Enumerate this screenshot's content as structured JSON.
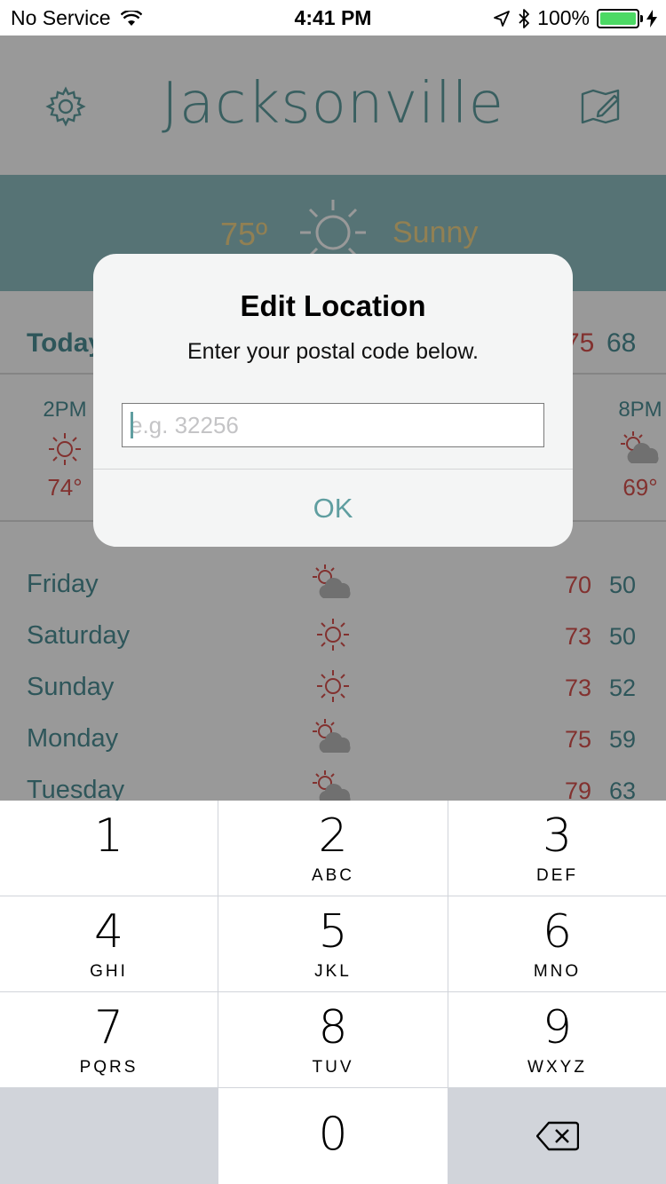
{
  "status_bar": {
    "carrier": "No Service",
    "time": "4:41 PM",
    "battery": "100%"
  },
  "header": {
    "title": "Jacksonville",
    "left_icon": "gear-icon",
    "right_icon": "edit-map-icon"
  },
  "current": {
    "temp": "75º",
    "condition": "Sunny",
    "icon": "sun-icon"
  },
  "today": {
    "label": "Today",
    "hi": "75",
    "lo": "68"
  },
  "hourly": [
    {
      "hour": "2PM",
      "temp": "74°",
      "icon": "sun-icon"
    },
    {
      "hour": "8PM",
      "temp": "69°",
      "icon": "partly-cloudy-icon"
    }
  ],
  "daily": [
    {
      "day": "Friday",
      "hi": "70",
      "lo": "50",
      "icon": "partly-cloudy-icon"
    },
    {
      "day": "Saturday",
      "hi": "73",
      "lo": "50",
      "icon": "sun-icon"
    },
    {
      "day": "Sunday",
      "hi": "73",
      "lo": "52",
      "icon": "sun-icon"
    },
    {
      "day": "Monday",
      "hi": "75",
      "lo": "59",
      "icon": "partly-cloudy-icon"
    },
    {
      "day": "Tuesday",
      "hi": "79",
      "lo": "63",
      "icon": "partly-cloudy-icon"
    }
  ],
  "alert": {
    "title": "Edit Location",
    "message": "Enter your postal code below.",
    "placeholder": "e.g. 32256",
    "value": "",
    "ok_label": "OK"
  },
  "keypad": {
    "keys": [
      {
        "num": "1",
        "letters": ""
      },
      {
        "num": "2",
        "letters": "ABC"
      },
      {
        "num": "3",
        "letters": "DEF"
      },
      {
        "num": "4",
        "letters": "GHI"
      },
      {
        "num": "5",
        "letters": "JKL"
      },
      {
        "num": "6",
        "letters": "MNO"
      },
      {
        "num": "7",
        "letters": "PQRS"
      },
      {
        "num": "8",
        "letters": "TUV"
      },
      {
        "num": "9",
        "letters": "WXYZ"
      },
      {
        "num": "0",
        "letters": ""
      }
    ],
    "delete_icon": "backspace-icon"
  },
  "colors": {
    "accent": "#5f9ea0",
    "hi_temp": "#d9534f",
    "current_bar": "#8fc0c3",
    "sun_text": "#f2d58a",
    "battery": "#4cd964"
  }
}
